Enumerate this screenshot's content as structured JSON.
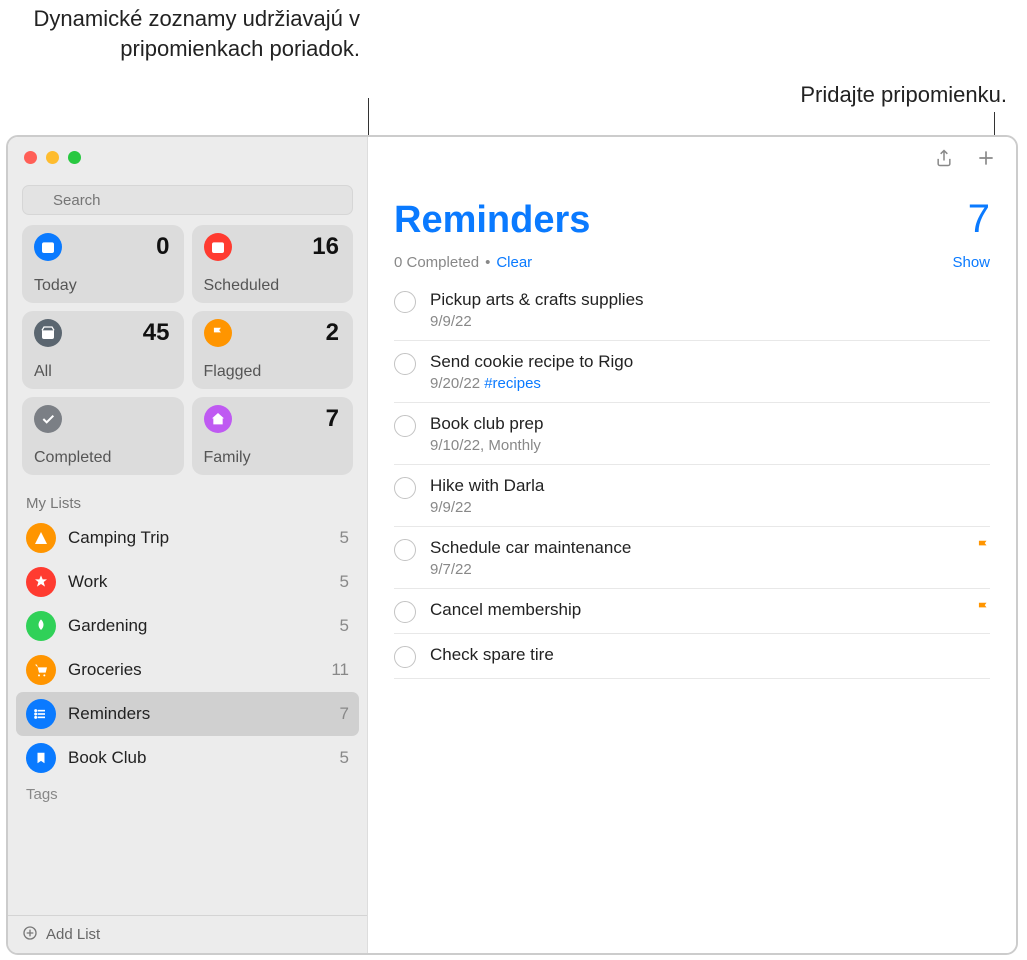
{
  "callouts": {
    "smart_lists": "Dynamické zoznamy udržiavajú v pripomienkach poriadok.",
    "add_reminder": "Pridajte pripomienku."
  },
  "search": {
    "placeholder": "Search"
  },
  "smart": [
    {
      "label": "Today",
      "count": "0",
      "color": "#0a7aff"
    },
    {
      "label": "Scheduled",
      "count": "16",
      "color": "#ff3b30"
    },
    {
      "label": "All",
      "count": "45",
      "color": "#5b6670"
    },
    {
      "label": "Flagged",
      "count": "2",
      "color": "#ff9500"
    },
    {
      "label": "Completed",
      "count": "",
      "color": "#7b7f85"
    },
    {
      "label": "Family",
      "count": "7",
      "color": "#bf5af2"
    }
  ],
  "sections": {
    "my_lists": "My Lists",
    "tags": "Tags"
  },
  "lists": [
    {
      "name": "Camping Trip",
      "count": "5",
      "color": "#ff9500"
    },
    {
      "name": "Work",
      "count": "5",
      "color": "#ff3b30"
    },
    {
      "name": "Gardening",
      "count": "5",
      "color": "#30d158"
    },
    {
      "name": "Groceries",
      "count": "11",
      "color": "#ff9500"
    },
    {
      "name": "Reminders",
      "count": "7",
      "color": "#0a7aff",
      "selected": true
    },
    {
      "name": "Book Club",
      "count": "5",
      "color": "#0a7aff"
    }
  ],
  "footer": {
    "add_list": "Add List"
  },
  "main": {
    "title": "Reminders",
    "count": "7",
    "completed": "0 Completed",
    "clear": "Clear",
    "show": "Show"
  },
  "reminders": [
    {
      "title": "Pickup arts & crafts supplies",
      "sub": "9/9/22"
    },
    {
      "title": "Send cookie recipe to Rigo",
      "sub": "9/20/22 ",
      "tag": "#recipes"
    },
    {
      "title": "Book club prep",
      "sub": "9/10/22, Monthly"
    },
    {
      "title": "Hike with Darla",
      "sub": "9/9/22"
    },
    {
      "title": "Schedule car maintenance",
      "sub": "9/7/22",
      "flag": true
    },
    {
      "title": "Cancel membership",
      "sub": "",
      "flag": true
    },
    {
      "title": "Check spare tire",
      "sub": ""
    }
  ]
}
